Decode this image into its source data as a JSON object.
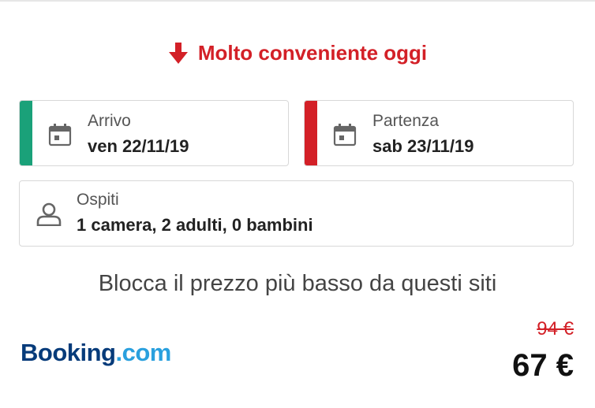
{
  "promo": {
    "text": "Molto conveniente oggi",
    "icon": "arrow-down-icon",
    "color": "#d32027"
  },
  "checkin": {
    "label": "Arrivo",
    "value": "ven 22/11/19",
    "accent": "#1aa179",
    "icon": "calendar-icon"
  },
  "checkout": {
    "label": "Partenza",
    "value": "sab 23/11/19",
    "accent": "#d32027",
    "icon": "calendar-icon"
  },
  "guests": {
    "label": "Ospiti",
    "value": "1 camera, 2 adulti, 0 bambini",
    "icon": "person-icon"
  },
  "lock_text": "Blocca il prezzo più basso da questi siti",
  "offer": {
    "provider_part1": "Booking",
    "provider_part2": ".com",
    "old_price": "94 €",
    "new_price": "67 €"
  }
}
